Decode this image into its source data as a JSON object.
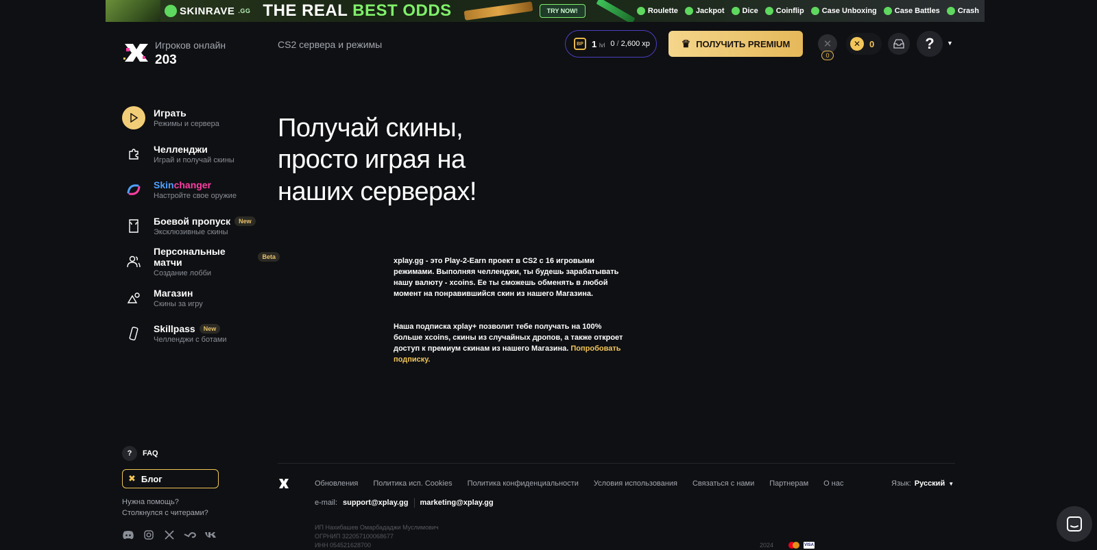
{
  "banner": {
    "brand": "SKINRAVE",
    "brand_suffix": ".GG",
    "headline_a": "THE REAL ",
    "headline_b": "BEST ODDS",
    "cta": "TRY NOW!",
    "games": [
      "Roulette",
      "Jackpot",
      "Dice",
      "Coinflip",
      "Case Unboxing",
      "Case Battles",
      "Crash"
    ]
  },
  "header": {
    "online_label": "Игроков онлайн",
    "online_count": "203",
    "nav_link": "CS2 сервера и режимы",
    "bp_icon": "BP",
    "bp_level": "1",
    "bp_level_unit": "lvl",
    "bp_xp_current": "0",
    "bp_xp_total": "2,600",
    "bp_xp_unit": "xp",
    "premium_label": "ПОЛУЧИТЬ PREMIUM",
    "case_count": "0",
    "coins": "0",
    "help_label": "?"
  },
  "sidebar": {
    "items": [
      {
        "title": "Играть",
        "subtitle": "Режимы и сервера",
        "badge": ""
      },
      {
        "title": "Челленджи",
        "subtitle": "Играй и получай скины",
        "badge": ""
      },
      {
        "title_a": "Skin",
        "title_b": "changer",
        "subtitle": "Настройте свое оружие",
        "badge": ""
      },
      {
        "title": "Боевой пропуск",
        "subtitle": "Эксклюзивные скины",
        "badge": "New"
      },
      {
        "title": "Персональные матчи",
        "subtitle": "Создание лобби",
        "badge": "Beta"
      },
      {
        "title": "Магазин",
        "subtitle": "Скины за игру",
        "badge": ""
      },
      {
        "title": "Skillpass",
        "subtitle": "Челленджи с ботами",
        "badge": "New"
      }
    ],
    "faq": "FAQ",
    "faq_icon": "?",
    "blog": "Блог",
    "help_link_1": "Нужна помощь?",
    "help_link_2": "Столкнулся с читерами?"
  },
  "hero": {
    "title_line_1": "Получай скины,",
    "title_line_2": "просто играя на",
    "title_line_3": "наших серверах!",
    "paragraph_1": "xplay.gg - это Play-2-Earn проект в CS2 с 16 игровыми режимами. Выполняя челленджи, ты будешь зарабатывать нашу валюту - xcoins. Ее ты сможешь обменять в любой момент на понравившийся скин из нашего Магазина.",
    "paragraph_2": "Наша подписка xplay+ позволит тебе получать на 100% больше xcoins, скины из случайных дропов, а также откроет доступ к премиум скинам из нашего Магазина. ",
    "paragraph_2_link": "Попробовать подписку."
  },
  "footer": {
    "links": [
      "Обновления",
      "Политика исп. Cookies",
      "Политика конфиденциальности",
      "Условия использования",
      "Связаться с нами",
      "Партнерам",
      "О нас"
    ],
    "lang_label": "Язык:",
    "lang_value": "Русский",
    "email_label": "e-mail:",
    "email_support": "support@xplay.gg",
    "email_marketing": "marketing@xplay.gg",
    "legal_1": "ИП Нахибашев Омарбададжи Муслимович",
    "legal_2": "ОГРНИП 322057100068677",
    "legal_3": "ИНН 054521628700",
    "year": "2024",
    "visa": "VISA"
  },
  "colors": {
    "background": "#0f1013",
    "accent_gold": "#f2c659",
    "premium_gradient_start": "#f4d68b",
    "bp_border": "#4b3fc4"
  }
}
